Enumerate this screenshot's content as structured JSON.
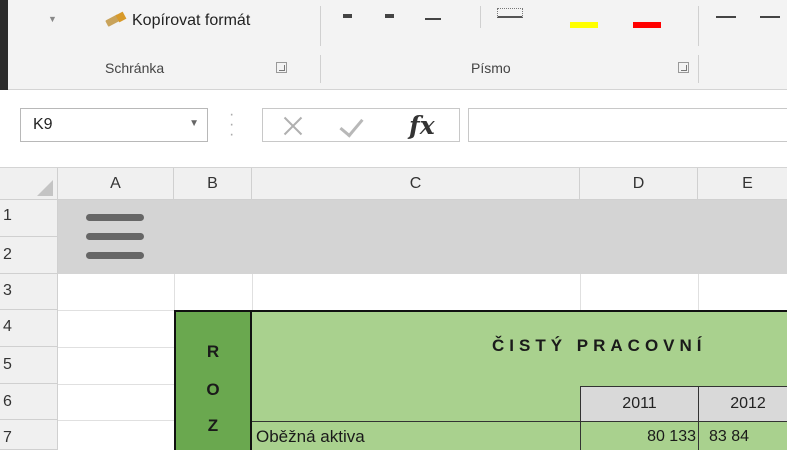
{
  "ribbon": {
    "copy_format_label": "Kopírovat formát",
    "groups": {
      "clipboard": "Schránka",
      "font": "Písmo"
    },
    "colors": {
      "highlight": "#ffff00",
      "font_color": "#ff0000"
    }
  },
  "formula_bar": {
    "name_box": "K9",
    "fx_label": "fx",
    "formula": ""
  },
  "columns": [
    "A",
    "B",
    "C",
    "D",
    "E"
  ],
  "rows": [
    "1",
    "2",
    "3",
    "4",
    "5",
    "6",
    "7"
  ],
  "sheet": {
    "side_letters": [
      "R",
      "O",
      "Z"
    ],
    "title": "ČISTÝ PRACOVNÍ",
    "years": [
      "2011",
      "2012"
    ],
    "row_label": "Oběžná aktiva",
    "row_values": [
      "80 133",
      "83 84"
    ],
    "colors": {
      "side_box": "#6aa84f",
      "title_box": "#a9d18e",
      "banner": "#d4d4d4"
    }
  }
}
